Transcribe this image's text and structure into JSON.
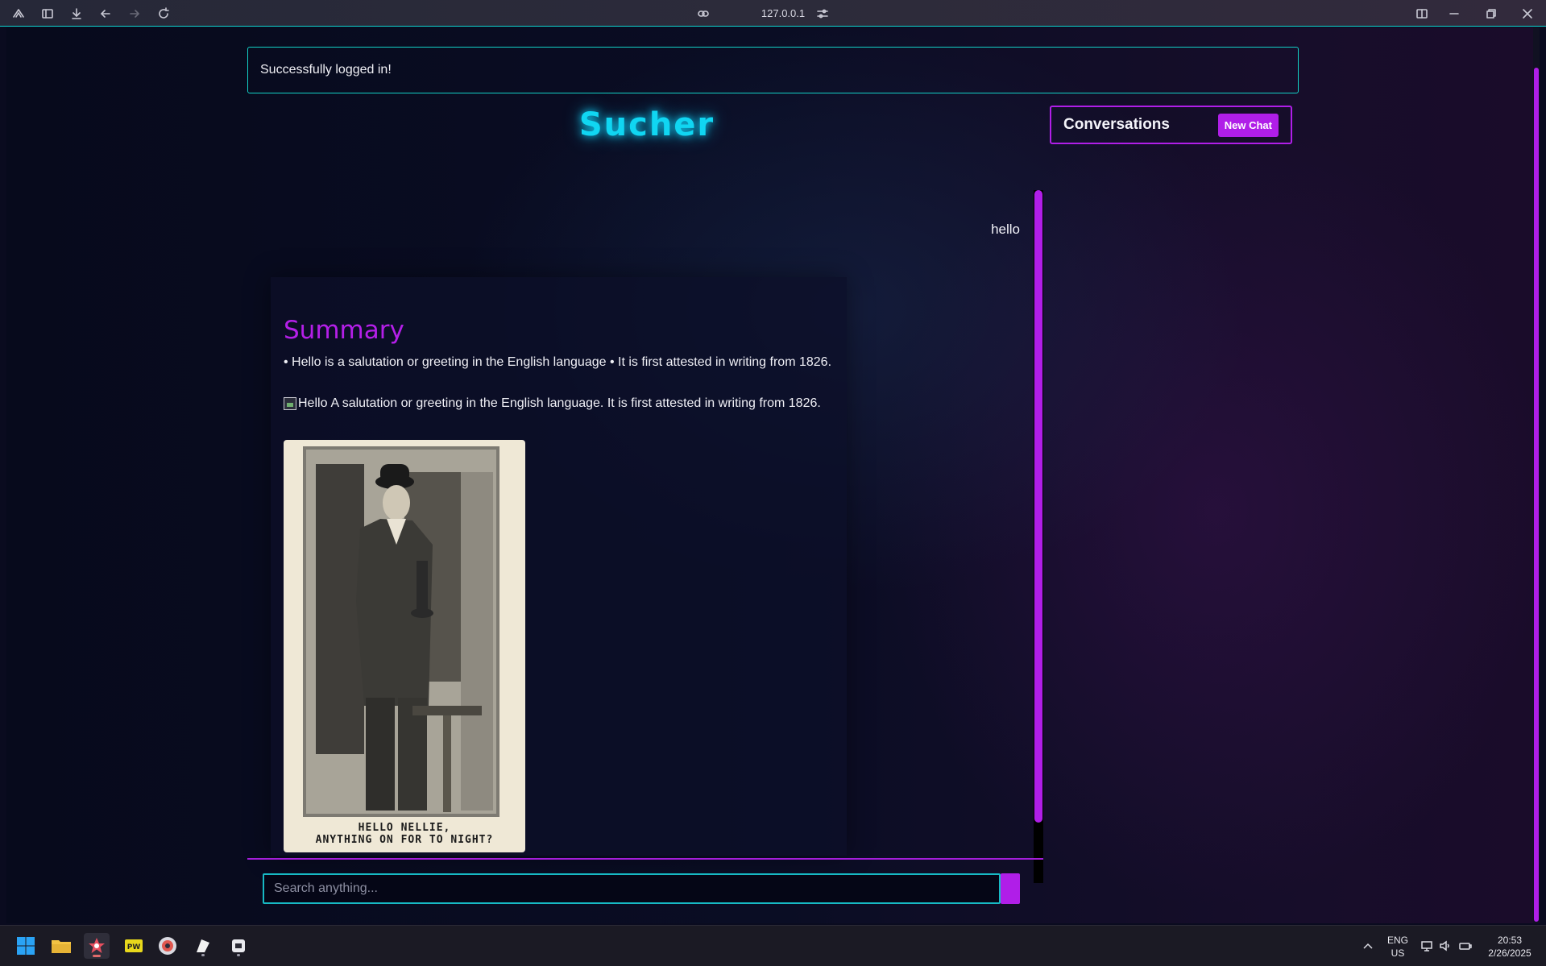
{
  "browser": {
    "address": "127.0.0.1"
  },
  "flash": {
    "message": "Successfully logged in!"
  },
  "brand": {
    "title": "Sucher"
  },
  "chat": {
    "user_message": "hello",
    "summary_heading": "Summary",
    "summary_text": "• Hello is a salutation or greeting in the English language • It is first attested in writing from 1826.",
    "image_alt": "Hello",
    "image_caption": "A salutation or greeting in the English language. It is first attested in writing from 1826.",
    "postcard_caption_line1": "HELLO NELLIE,",
    "postcard_caption_line2": "ANYTHING ON FOR TO NIGHT?"
  },
  "search": {
    "placeholder": "Search anything..."
  },
  "sidebar": {
    "title": "Conversations",
    "new_chat_label": "New Chat"
  },
  "taskbar": {
    "language_line1": "ENG",
    "language_line2": "US",
    "time": "20:53",
    "date": "2/26/2025"
  },
  "colors": {
    "accent_purple": "#b01ee8",
    "accent_cyan": "#10d6f2",
    "flash_border": "#13d1c6"
  }
}
